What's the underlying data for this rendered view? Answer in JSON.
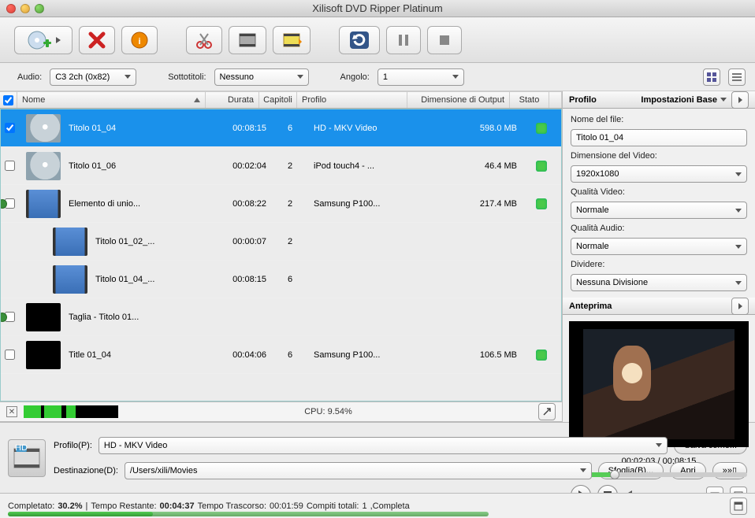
{
  "window": {
    "title": "Xilisoft DVD Ripper Platinum"
  },
  "options": {
    "audio_label": "Audio:",
    "audio_value": "C3 2ch (0x82)",
    "subtitle_label": "Sottotitoli:",
    "subtitle_value": "Nessuno",
    "angle_label": "Angolo:",
    "angle_value": "1"
  },
  "columns": {
    "name": "Nome",
    "duration": "Durata",
    "chapters": "Capitoli",
    "profile": "Profilo",
    "outputsize": "Dimensione di Output",
    "status": "Stato"
  },
  "rows": [
    {
      "checked": true,
      "selected": true,
      "thumb": "disc",
      "name": "Titolo 01_04",
      "dur": "00:08:15",
      "chap": "6",
      "prof": "HD - MKV Video",
      "size": "598.0 MB",
      "dot": true
    },
    {
      "checked": false,
      "thumb": "disc",
      "name": "Titolo 01_06",
      "dur": "00:02:04",
      "chap": "2",
      "prof": "iPod touch4 - ...",
      "size": "46.4 MB",
      "dot": true
    },
    {
      "checked": false,
      "thumb": "film",
      "greenmark": true,
      "name": "Elemento di unio...",
      "dur": "00:08:22",
      "chap": "2",
      "prof": "Samsung P100...",
      "size": "217.4 MB",
      "dot": true
    },
    {
      "child": true,
      "thumb": "film",
      "name": "Titolo 01_02_...",
      "dur": "00:00:07",
      "chap": "2",
      "prof": "",
      "size": "",
      "dot": false
    },
    {
      "child": true,
      "thumb": "film",
      "name": "Titolo 01_04_...",
      "dur": "00:08:15",
      "chap": "6",
      "prof": "",
      "size": "",
      "dot": false
    },
    {
      "checked": false,
      "thumb": "black",
      "greenmark": true,
      "name": "Taglia - Titolo 01...",
      "dur": "",
      "chap": "",
      "prof": "",
      "size": "",
      "dot": false
    },
    {
      "checked": false,
      "thumb": "black",
      "name": "Title 01_04",
      "dur": "00:04:06",
      "chap": "6",
      "prof": "Samsung P100...",
      "size": "106.5 MB",
      "dot": true
    }
  ],
  "cpu": {
    "label": "CPU: 9.54%",
    "segs": [
      [
        0,
        18
      ],
      [
        22,
        40
      ],
      [
        45,
        55
      ]
    ]
  },
  "bottom": {
    "profile_label": "Profilo(P):",
    "profile_value": "HD - MKV Video",
    "saveas": "Salva come...",
    "dest_label": "Destinazione(D):",
    "dest_value": "/Users/xili/Movies",
    "browse": "Sfoglia(B)...",
    "open": "Apri",
    "devices": "»»▯"
  },
  "status": {
    "completed_label": "Completato:",
    "completed_val": "30.2%",
    "remaining_label": "Tempo Restante:",
    "remaining_val": "00:04:37",
    "elapsed_label": "Tempo Trascorso:",
    "elapsed_val": "00:01:59",
    "tasks_label": "Compiti totali:",
    "tasks_val": "1",
    "tail": ",Completa",
    "progress_pct": 30.2
  },
  "panel": {
    "tab_profile": "Profilo",
    "tab_settings": "Impostazioni Base",
    "filename_label": "Nome del file:",
    "filename_value": "Titolo 01_04",
    "videosize_label": "Dimensione del Video:",
    "videosize_value": "1920x1080",
    "videoq_label": "Qualità Video:",
    "videoq_value": "Normale",
    "audioq_label": "Qualità Audio:",
    "audioq_value": "Normale",
    "split_label": "Dividere:",
    "split_value": "Nessuna Divisione",
    "preview_label": "Anteprima",
    "time": "00:02:03 / 00:08:15",
    "pv_pct": 25
  }
}
